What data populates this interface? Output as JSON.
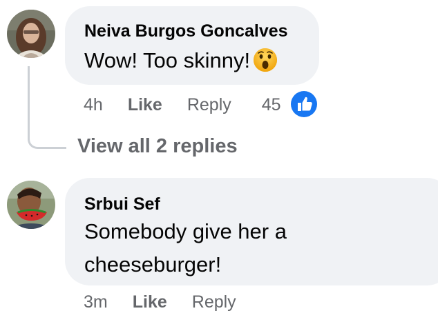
{
  "comments": [
    {
      "author": "Neiva Burgos Goncalves",
      "text": "Wow! Too skinny!",
      "emoji": "wow-emoji",
      "time": "4h",
      "like_label": "Like",
      "reply_label": "Reply",
      "reaction_count": "45",
      "reaction_icon": "thumbs-up-icon"
    },
    {
      "author": "Srbui Sef",
      "text": "Somebody give her a cheeseburger!",
      "time": "3m",
      "like_label": "Like",
      "reply_label": "Reply"
    }
  ],
  "thread": {
    "view_replies_label": "View all 2 replies"
  },
  "colors": {
    "bubble_bg": "#f0f2f5",
    "meta_text": "#65676b",
    "primary_text": "#050505",
    "like_blue": "#1877f2",
    "thread_line": "#ccd0d5"
  }
}
